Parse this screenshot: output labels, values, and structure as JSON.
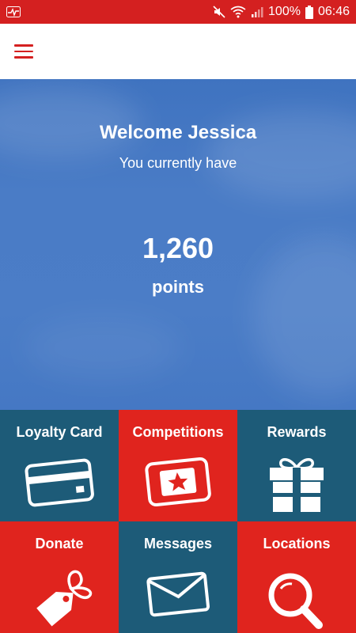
{
  "status_bar": {
    "battery": "100%",
    "time": "06:46",
    "icons": [
      "activity-icon",
      "mute-icon",
      "wifi-icon",
      "signal-icon",
      "battery-icon"
    ]
  },
  "app_bar": {
    "menu_icon": "hamburger-menu-icon"
  },
  "hero": {
    "welcome": "Welcome Jessica",
    "subtitle": "You currently have",
    "points": "1,260",
    "points_label": "points"
  },
  "tiles": [
    {
      "label": "Loyalty Card",
      "icon": "credit-card-icon"
    },
    {
      "label": "Competitions",
      "icon": "ticket-star-icon"
    },
    {
      "label": "Rewards",
      "icon": "gift-icon"
    },
    {
      "label": "Donate",
      "icon": "tag-icon"
    },
    {
      "label": "Messages",
      "icon": "envelope-icon"
    },
    {
      "label": "Locations",
      "icon": "magnifier-icon"
    }
  ],
  "colors": {
    "brand_red": "#d42020",
    "tile_teal": "#1d5b78",
    "tile_red": "#e0241e",
    "hero_blue": "#4a7cc6"
  }
}
